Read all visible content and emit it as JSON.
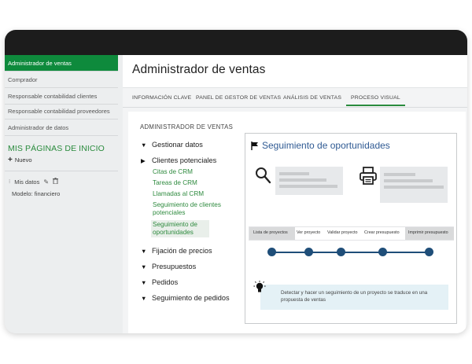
{
  "sidebar": {
    "items": [
      {
        "label": "Administrador de ventas"
      },
      {
        "label": "Comprador"
      },
      {
        "label": "Responsable contabilidad clientes"
      },
      {
        "label": "Responsable contabilidad proveedores"
      },
      {
        "label": "Administrador de datos"
      }
    ],
    "my_pages_title": "MIS PÁGINAS DE INICIO",
    "new_label": "Nuevo",
    "my_data_label": "Mis datos",
    "model_label": "Modelo: financiero"
  },
  "header": {
    "title": "Administrador de ventas"
  },
  "tabs": [
    {
      "label": "INFORMACIÓN CLAVE"
    },
    {
      "label": "PANEL DE GESTOR DE VENTAS"
    },
    {
      "label": "ANÁLISIS DE VENTAS"
    },
    {
      "label": "PROCESO VISUAL"
    }
  ],
  "panel": {
    "title": "ADMINISTRADOR DE VENTAS",
    "tree": {
      "gestionar": "Gestionar datos",
      "clientes": "Clientes potenciales",
      "subitems": [
        "Citas de CRM",
        "Tareas de CRM",
        "Llamadas al CRM",
        "Seguimiento de clientes potenciales",
        "Seguimiento de oportunidades"
      ],
      "precios": "Fijación de precios",
      "presupuestos": "Presupuestos",
      "pedidos": "Pedidos",
      "seguimiento_pedidos": "Seguimiento de pedidos"
    }
  },
  "visual": {
    "title": "Seguimiento de oportunidades",
    "steps": [
      "Lista de proyectos",
      "Ver proyecto",
      "Validar proyecto",
      "Crear presupuesto",
      "Imprimir presupuesto"
    ],
    "tip": "Detectar y hacer un seguimiento de un proyecto se traduce en una propuesta de ventas"
  },
  "colors": {
    "accent": "#0e8a3c",
    "link": "#2e8a3e",
    "title_blue": "#2f5a93",
    "timeline": "#1f4e79"
  }
}
